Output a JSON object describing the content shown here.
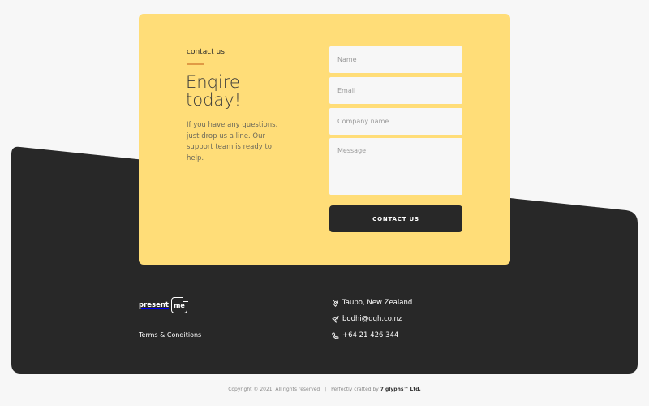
{
  "colors": {
    "background": "#f7f7f7",
    "card": "#ffdd78",
    "accent": "#e09a45",
    "footer": "#282828",
    "text_dark": "#2a2a2a"
  },
  "contact_card": {
    "eyebrow": "contact us",
    "headline": "Enqire today!",
    "blurb": "If you have any questions, just drop us a line. Our support team is ready to help.",
    "form": {
      "name_placeholder": "Name",
      "email_placeholder": "Email",
      "company_placeholder": "Company name",
      "message_placeholder": "Message",
      "submit_label": "CONTACT US"
    }
  },
  "footer": {
    "logo": {
      "word": "present",
      "badge": "me"
    },
    "terms_label": "Terms & Conditions",
    "contact": {
      "location": {
        "icon": "map-pin-icon",
        "text": "Taupo, New Zealand"
      },
      "email": {
        "icon": "send-icon",
        "text": "bodhi@dgh.co.nz"
      },
      "phone": {
        "icon": "phone-icon",
        "text": "+64 21 426 344"
      }
    }
  },
  "bottom_bar": {
    "copyright": "Copyright © 2021. All rights reserved",
    "separator": "|",
    "crafted_prefix": "Perfectly crafted by",
    "crafted_by": "7 glyphs™ Ltd."
  }
}
